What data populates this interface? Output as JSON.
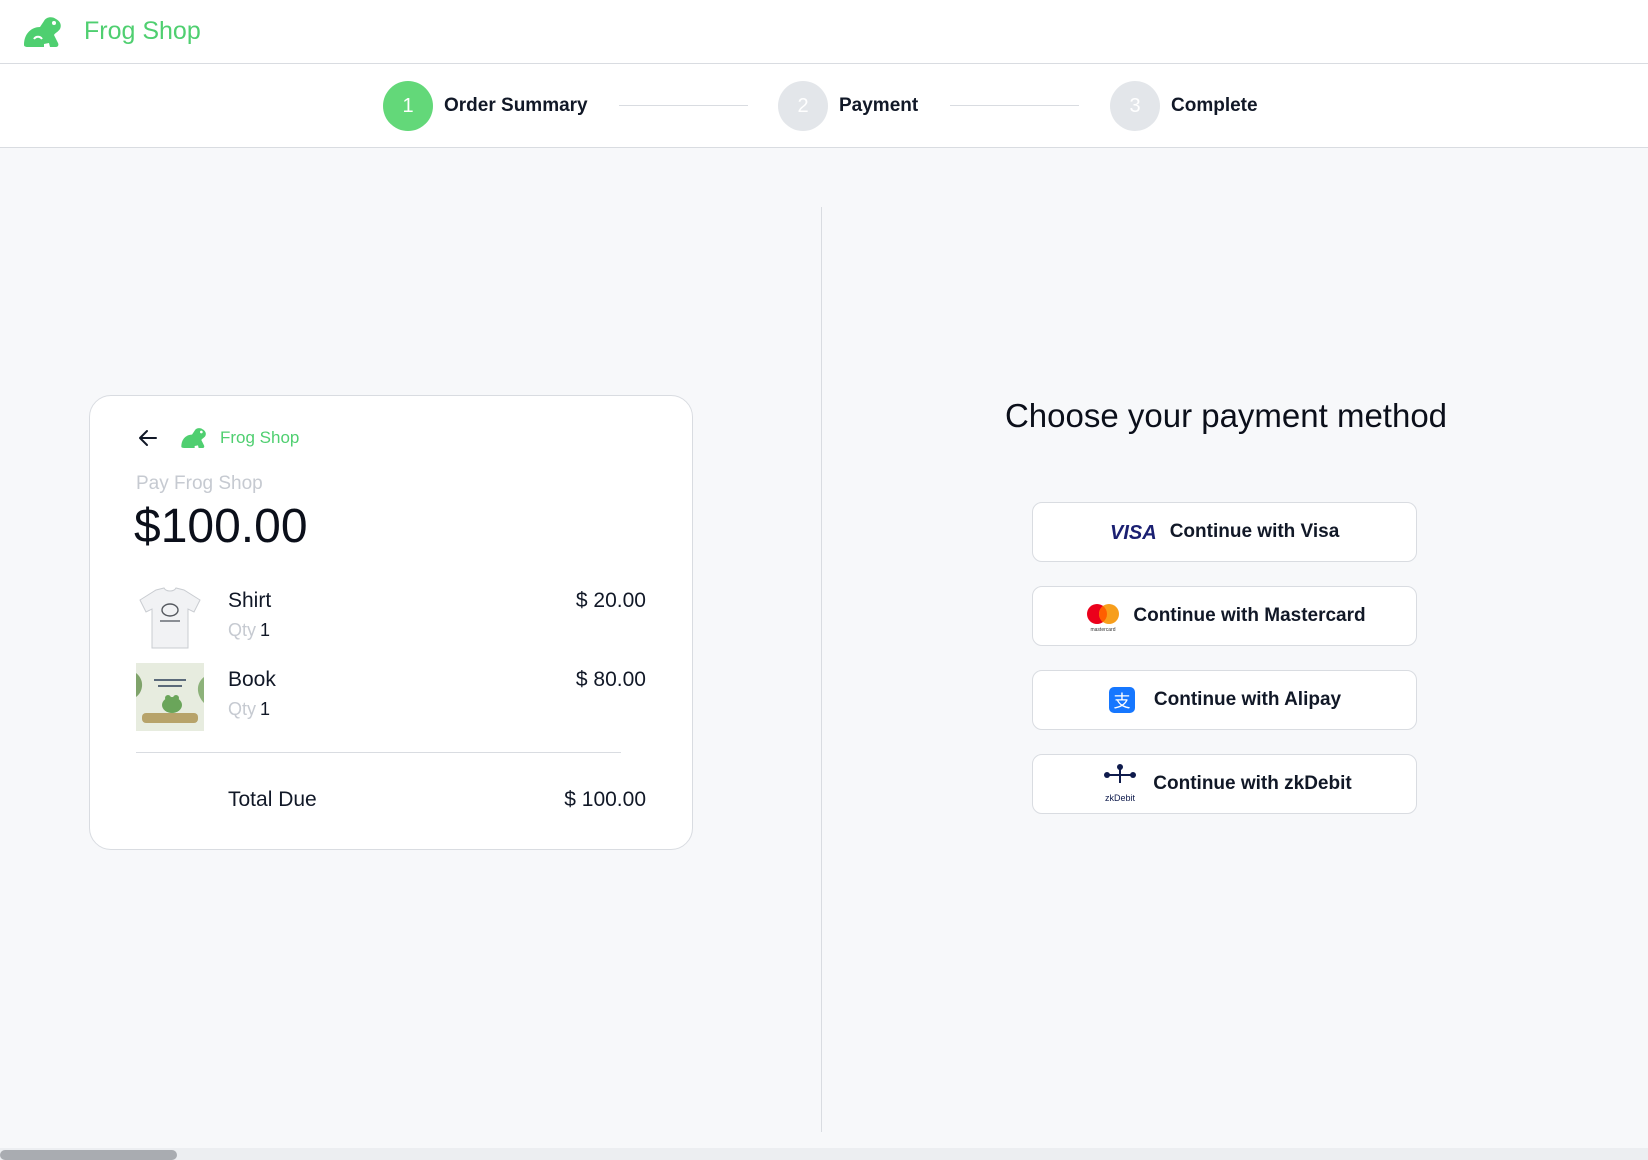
{
  "header": {
    "brand_name": "Frog Shop",
    "logo_icon": "frog-icon"
  },
  "stepper": {
    "steps": [
      {
        "number": "1",
        "label": "Order Summary",
        "state": "active"
      },
      {
        "number": "2",
        "label": "Payment",
        "state": "inactive"
      },
      {
        "number": "3",
        "label": "Complete",
        "state": "inactive"
      }
    ]
  },
  "order_card": {
    "back_icon": "arrow-left-icon",
    "brand_name": "Frog Shop",
    "pay_label": "Pay Frog Shop",
    "amount": "$100.00",
    "items": [
      {
        "name": "Shirt",
        "qty_label": "Qty",
        "qty": "1",
        "price": "$ 20.00",
        "image_icon": "shirt-thumbnail"
      },
      {
        "name": "Book",
        "qty_label": "Qty",
        "qty": "1",
        "price": "$ 80.00",
        "image_icon": "book-thumbnail"
      }
    ],
    "total_label": "Total Due",
    "total_value": "$ 100.00"
  },
  "payment": {
    "title": "Choose your payment method",
    "methods": [
      {
        "label": "Continue with Visa",
        "icon": "visa-icon",
        "icon_text": "VISA"
      },
      {
        "label": "Continue with Mastercard",
        "icon": "mastercard-icon",
        "icon_text": "mastercard"
      },
      {
        "label": "Continue with Alipay",
        "icon": "alipay-icon",
        "icon_text": "支"
      },
      {
        "label": "Continue with zkDebit",
        "icon": "zkdebit-icon",
        "icon_text": "zkDebit"
      }
    ]
  },
  "colors": {
    "brand_green": "#4fcf70",
    "step_active": "#63d879",
    "step_inactive": "#e3e6ea",
    "visa_blue": "#1a1f71",
    "alipay_blue": "#1677ff"
  }
}
